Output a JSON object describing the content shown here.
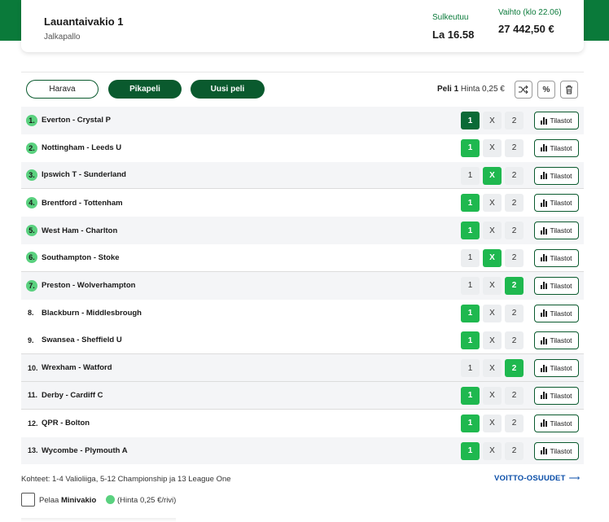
{
  "header": {
    "title": "Lauantaivakio 1",
    "sport": "Jalkapallo",
    "closes_label": "Sulkeutuu",
    "closes_value": "La 16.58",
    "turnover_label": "Vaihto (klo 22.06)",
    "turnover_value": "27 442,50 €"
  },
  "toolbar": {
    "harava_label": "Harava",
    "quick_label": "Pikapeli",
    "new_label": "Uusi peli",
    "game_label": "Peli 1",
    "price_label": "Hinta 0,25 €",
    "percent_icon_label": "%"
  },
  "matches": [
    {
      "num": "1.",
      "name": "Everton - Crystal P",
      "selected": "1",
      "stats_label": "Tilastot"
    },
    {
      "num": "2.",
      "name": "Nottingham - Leeds U",
      "selected": "1",
      "stats_label": "Tilastot"
    },
    {
      "num": "3.",
      "name": "Ipswich T - Sunderland",
      "selected": "X",
      "stats_label": "Tilastot"
    },
    {
      "num": "4.",
      "name": "Brentford - Tottenham",
      "selected": "1",
      "stats_label": "Tilastot"
    },
    {
      "num": "5.",
      "name": "West Ham - Charlton",
      "selected": "1",
      "stats_label": "Tilastot"
    },
    {
      "num": "6.",
      "name": "Southampton - Stoke",
      "selected": "X",
      "stats_label": "Tilastot"
    },
    {
      "num": "7.",
      "name": "Preston - Wolverhampton",
      "selected": "2",
      "stats_label": "Tilastot"
    },
    {
      "num": "8.",
      "name": "Blackburn - Middlesbrough",
      "selected": "1",
      "stats_label": "Tilastot"
    },
    {
      "num": "9.",
      "name": "Swansea - Sheffield U",
      "selected": "1",
      "stats_label": "Tilastot"
    },
    {
      "num": "10.",
      "name": "Wrexham - Watford",
      "selected": "2",
      "stats_label": "Tilastot"
    },
    {
      "num": "11.",
      "name": "Derby - Cardiff C",
      "selected": "1",
      "stats_label": "Tilastot"
    },
    {
      "num": "12.",
      "name": "QPR - Bolton",
      "selected": "1",
      "stats_label": "Tilastot"
    },
    {
      "num": "13.",
      "name": "Wycombe - Plymouth A",
      "selected": "1",
      "stats_label": "Tilastot"
    }
  ],
  "options": [
    "1",
    "X",
    "2"
  ],
  "footer": {
    "note": "Kohteet: 1-4 Valioliiga, 5-12 Championship ja 13 League One",
    "odds_link": "VOITTO-OSUUDET",
    "mini_prefix": "Pelaa",
    "mini_name": "Minivakio",
    "mini_price": "(Hinta 0,25 €/rivi)"
  },
  "colors": {
    "brand_green": "#0a7a3a",
    "selected_green": "#1fb84f",
    "link_blue": "#0a4ea8"
  }
}
